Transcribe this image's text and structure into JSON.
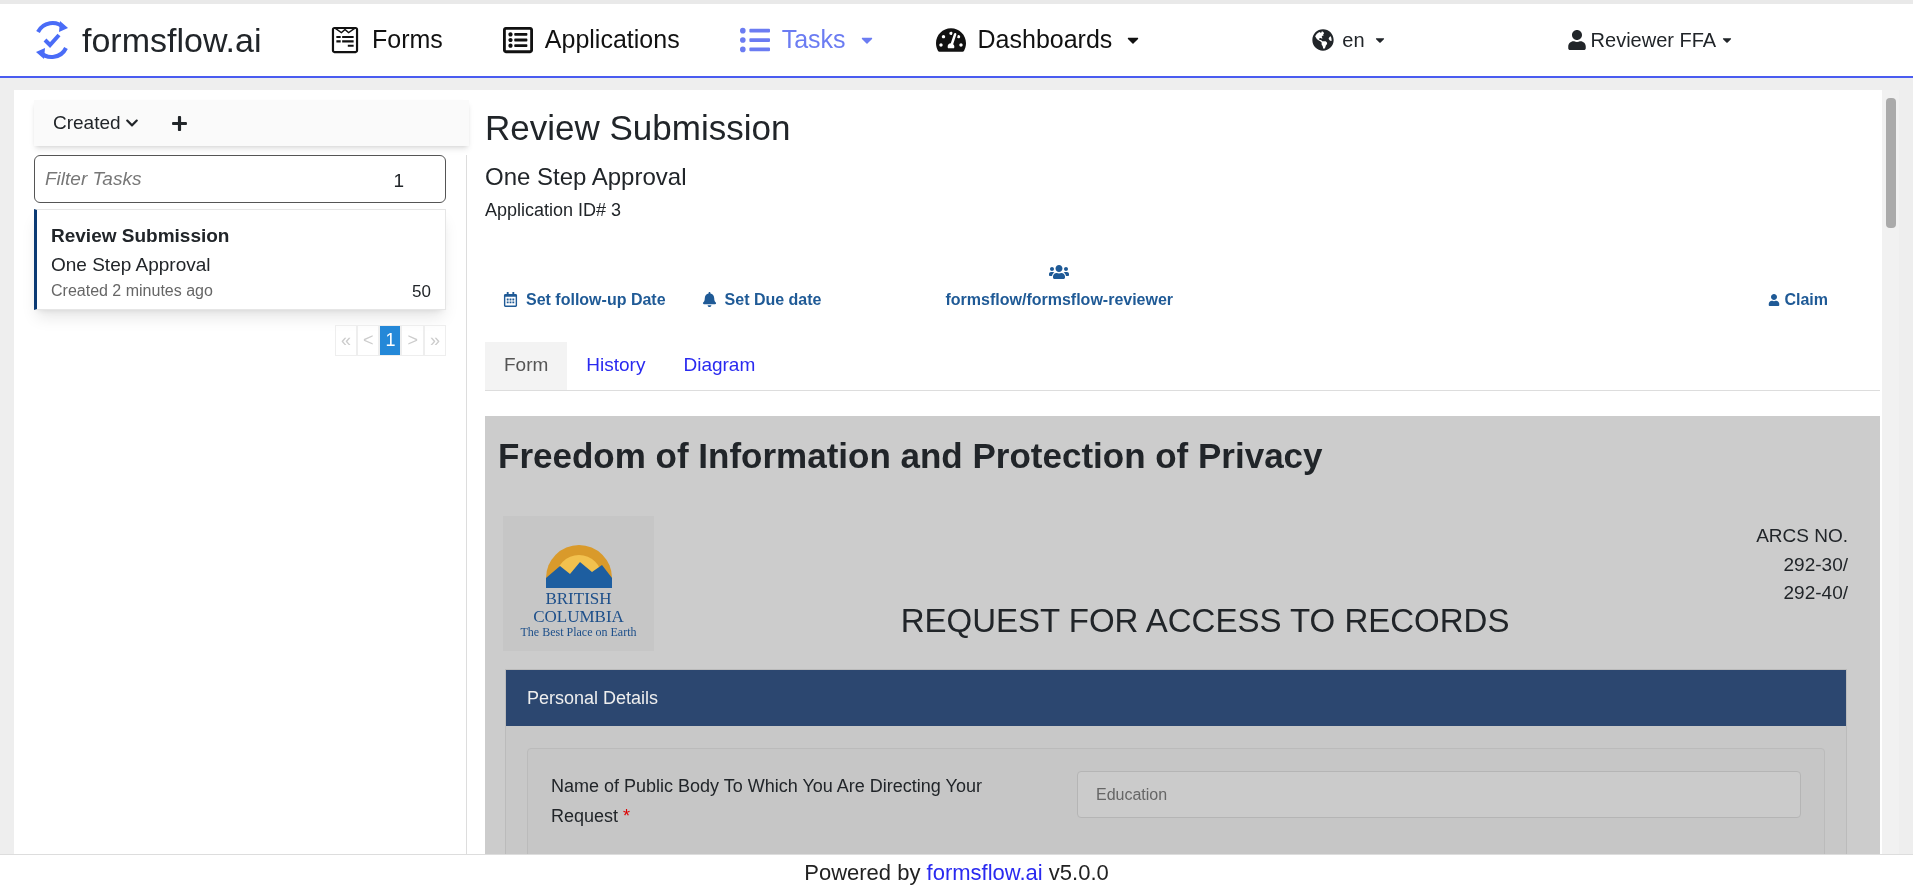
{
  "navbar": {
    "brand": "formsflow.ai",
    "items": [
      {
        "label": "Forms",
        "selected": false,
        "kind": "form",
        "dropdown": false
      },
      {
        "label": "Applications",
        "selected": false,
        "kind": "list",
        "dropdown": false
      },
      {
        "label": "Tasks",
        "selected": true,
        "kind": "tasks",
        "dropdown": true
      },
      {
        "label": "Dashboards",
        "selected": false,
        "kind": "gauge",
        "dropdown": true
      }
    ],
    "language": "en",
    "user": "Reviewer FFA"
  },
  "sidebar": {
    "sort": "Created",
    "filter": {
      "placeholder": "Filter Tasks",
      "count": "1"
    },
    "tasks": [
      {
        "title": "Review Submission",
        "process": "One Step Approval",
        "created": "Created 2 minutes ago",
        "priority": "50",
        "selected": true
      }
    ],
    "pagination": [
      {
        "label": "«",
        "selected": false
      },
      {
        "label": "<",
        "selected": false
      },
      {
        "label": "1",
        "selected": true
      },
      {
        "label": ">",
        "selected": false
      },
      {
        "label": "»",
        "selected": false
      }
    ]
  },
  "task": {
    "title": "Review Submission",
    "process": "One Step Approval",
    "application_id": "Application ID# 3",
    "actions": {
      "follow_up": "Set follow-up Date",
      "due": "Set Due date",
      "group": "formsflow/formsflow-reviewer",
      "claim": "Claim"
    },
    "tabs": [
      {
        "label": "Form",
        "selected": true
      },
      {
        "label": "History",
        "selected": false
      },
      {
        "label": "Diagram",
        "selected": false
      }
    ]
  },
  "form": {
    "heading": "Freedom of Information and Protection of Privacy",
    "logo": [
      "BRITISH",
      "COLUMBIA",
      "The Best Place on Earth"
    ],
    "arcs": [
      "ARCS NO.",
      "292-30/",
      "292-40/"
    ],
    "title": "REQUEST FOR ACCESS TO RECORDS",
    "panel": "Personal Details",
    "field": {
      "label": "Name of Public Body To Which You Are Directing Your Request",
      "required_mark": "*",
      "value": "Education"
    }
  },
  "footer": {
    "prefix": "Powered by",
    "link": "formsflow.ai",
    "suffix": "v5.0.0"
  }
}
